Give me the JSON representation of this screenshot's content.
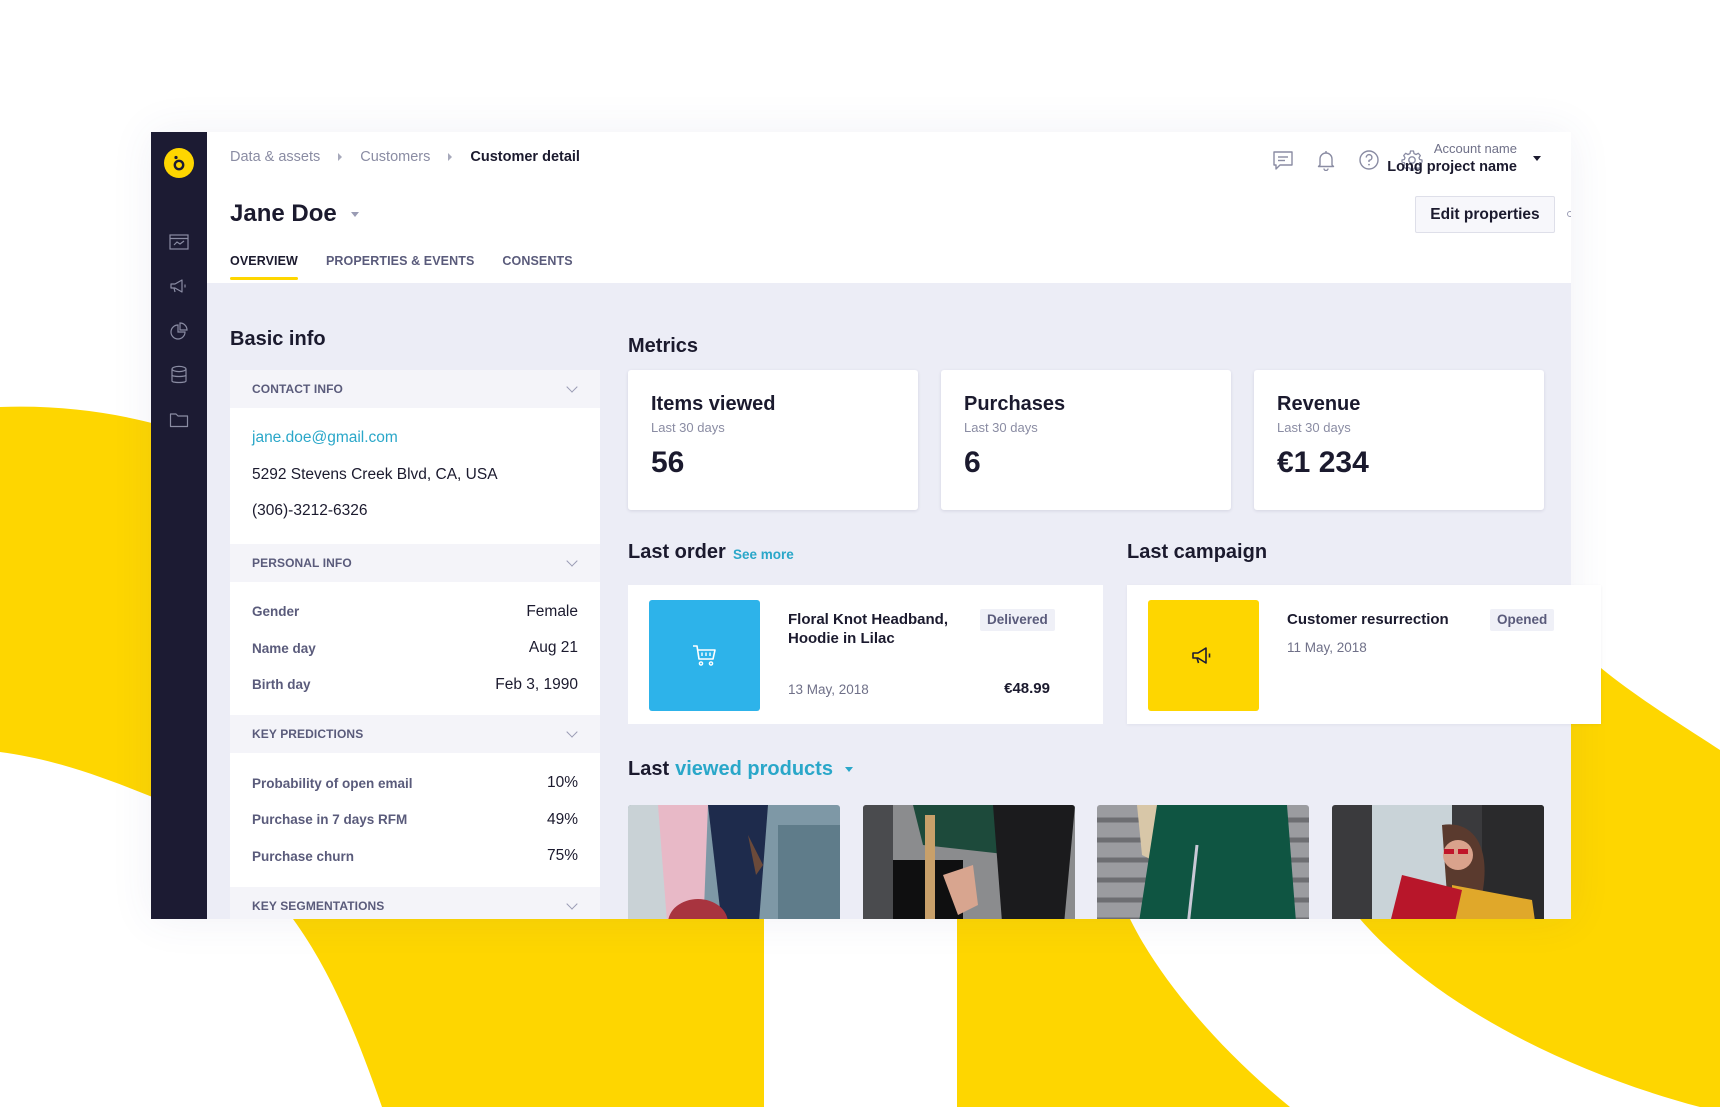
{
  "breadcrumb": {
    "items": [
      "Data & assets",
      "Customers"
    ],
    "current": "Customer detail"
  },
  "header": {
    "icons": [
      "chat-icon",
      "bell-icon",
      "help-icon",
      "gear-icon"
    ],
    "account_label": "Account name",
    "project_name": "Long project name"
  },
  "customer": {
    "name": "Jane Doe",
    "edit_button": "Edit properties"
  },
  "tabs": [
    {
      "label": "OVERVIEW",
      "active": true
    },
    {
      "label": "PROPERTIES & EVENTS",
      "active": false
    },
    {
      "label": "CONSENTS",
      "active": false
    }
  ],
  "sidebar": {
    "icons": [
      "dashboard-icon",
      "megaphone-icon",
      "pie-chart-icon",
      "database-icon",
      "folder-icon"
    ]
  },
  "basic_info": {
    "title": "Basic info",
    "contact": {
      "header": "CONTACT INFO",
      "email": "jane.doe@gmail.com",
      "address": "5292 Stevens Creek Blvd, CA, USA",
      "phone": "(306)-3212-6326"
    },
    "personal": {
      "header": "PERSONAL INFO",
      "rows": [
        {
          "key": "Gender",
          "value": "Female"
        },
        {
          "key": "Name day",
          "value": "Aug 21"
        },
        {
          "key": "Birth day",
          "value": "Feb 3, 1990"
        }
      ]
    },
    "predictions": {
      "header": "KEY PREDICTIONS",
      "rows": [
        {
          "key": "Probability of open email",
          "value": "10%"
        },
        {
          "key": "Purchase in 7 days RFM",
          "value": "49%"
        },
        {
          "key": "Purchase churn",
          "value": "75%"
        }
      ]
    },
    "segmentations": {
      "header": "KEY SEGMENTATIONS"
    }
  },
  "metrics": {
    "title": "Metrics",
    "cards": [
      {
        "title": "Items viewed",
        "period": "Last 30 days",
        "value": "56"
      },
      {
        "title": "Purchases",
        "period": "Last 30 days",
        "value": "6"
      },
      {
        "title": "Revenue",
        "period": "Last 30 days",
        "value": "€1 234"
      }
    ]
  },
  "last_order": {
    "title": "Last order",
    "see_more": "See more",
    "name": "Floral Knot Headband, Hoodie in Lilac",
    "status": "Delivered",
    "date": "13 May, 2018",
    "price": "€48.99",
    "thumb_color": "#2db3ea"
  },
  "last_campaign": {
    "title": "Last campaign",
    "name": "Customer resurrection",
    "status": "Opened",
    "date": "11 May, 2018",
    "thumb_color": "#fed600"
  },
  "last_viewed": {
    "prefix": "Last",
    "accent": "viewed products",
    "products": [
      {
        "alt": "pink coat with red round bag"
      },
      {
        "alt": "black bag with striped strap"
      },
      {
        "alt": "green fur coat"
      },
      {
        "alt": "woman with red bag and sunglasses"
      }
    ]
  },
  "colors": {
    "brand_yellow": "#fed600",
    "accent_blue": "#2aa7c9",
    "sidebar": "#1c1b33"
  }
}
